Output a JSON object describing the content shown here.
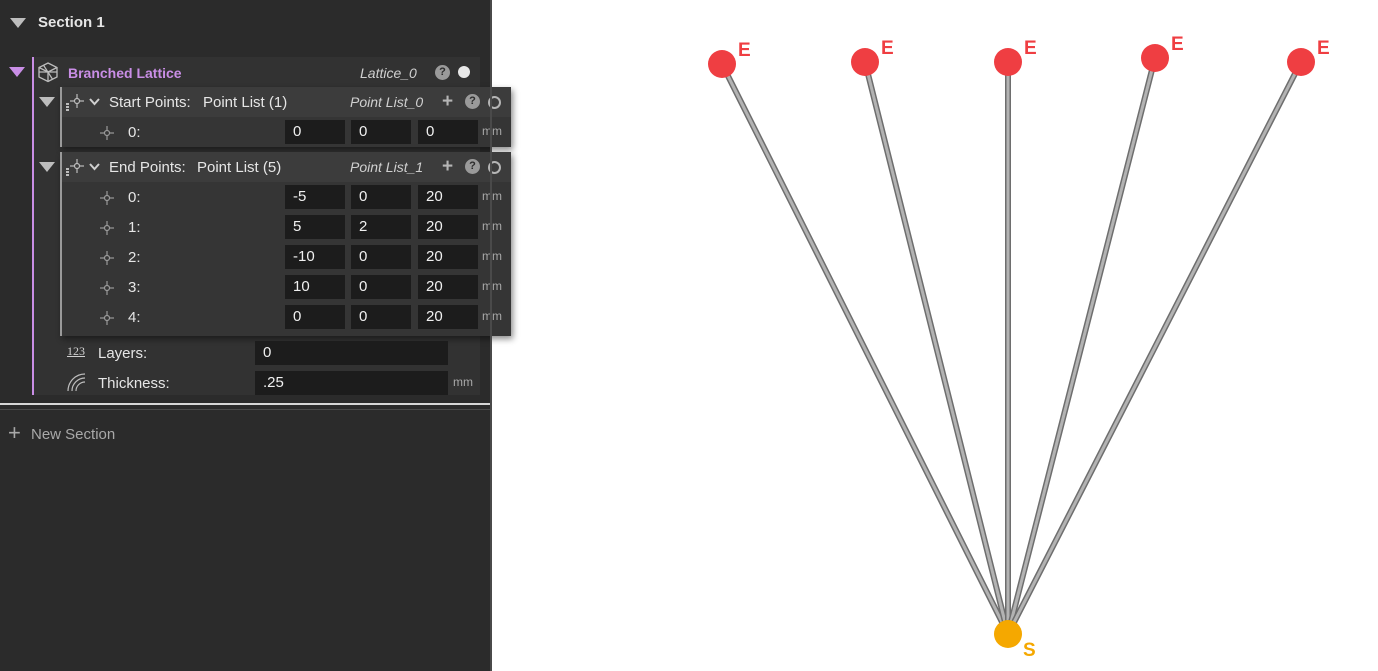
{
  "section": {
    "title": "Section 1"
  },
  "lattice": {
    "title": "Branched Lattice",
    "instance_name": "Lattice_0",
    "start_points": {
      "label": "Start Points:",
      "type": "Point List (1)",
      "instance_name": "Point List_0",
      "rows": [
        {
          "index": "0:",
          "x": "0",
          "y": "0",
          "z": "0",
          "unit": "mm"
        }
      ]
    },
    "end_points": {
      "label": "End Points:",
      "type": "Point List (5)",
      "instance_name": "Point List_1",
      "rows": [
        {
          "index": "0:",
          "x": "-5",
          "y": "0",
          "z": "20",
          "unit": "mm"
        },
        {
          "index": "1:",
          "x": "5",
          "y": "2",
          "z": "20",
          "unit": "mm"
        },
        {
          "index": "2:",
          "x": "-10",
          "y": "0",
          "z": "20",
          "unit": "mm"
        },
        {
          "index": "3:",
          "x": "10",
          "y": "0",
          "z": "20",
          "unit": "mm"
        },
        {
          "index": "4:",
          "x": "0",
          "y": "0",
          "z": "20",
          "unit": "mm"
        }
      ]
    },
    "layers": {
      "label": "Layers:",
      "value": "0"
    },
    "thickness": {
      "label": "Thickness:",
      "value": ".25",
      "unit": "mm"
    }
  },
  "new_section": {
    "label": "New Section"
  },
  "viewport": {
    "end_label": "E",
    "start_label": "S",
    "colors": {
      "end": "#ef3e42",
      "start": "#f5a800",
      "strut": "#9a9a9a",
      "panel": "#2b2b2b",
      "accent": "#c98ee6"
    }
  }
}
